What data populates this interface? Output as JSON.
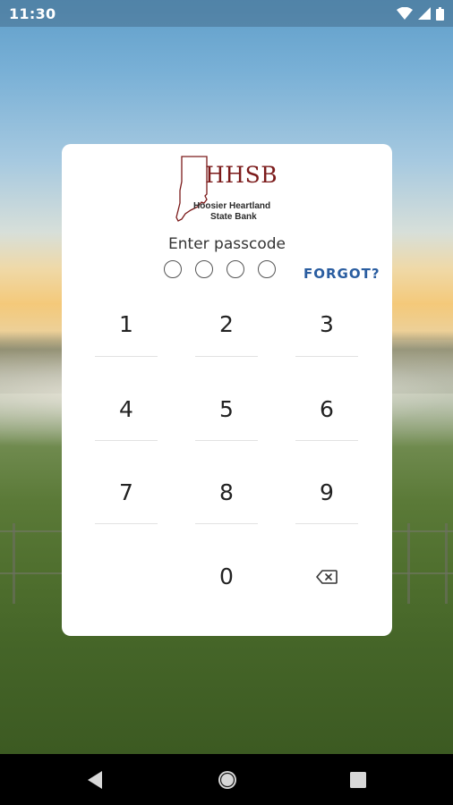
{
  "status_bar": {
    "time": "11:30",
    "icons": [
      "wifi-icon",
      "signal-icon",
      "battery-icon"
    ]
  },
  "logo": {
    "main": "HHSB",
    "line1": "Hoosier Heartland",
    "line2": "State Bank",
    "brand_color": "#7b1a1a"
  },
  "passcode": {
    "prompt": "Enter passcode",
    "digits_entered": 0,
    "digits_total": 4,
    "forgot_label": "FORGOT?",
    "link_color": "#2a5da0"
  },
  "keypad": {
    "keys": [
      "1",
      "2",
      "3",
      "4",
      "5",
      "6",
      "7",
      "8",
      "9",
      "0"
    ],
    "delete_icon": "backspace-icon"
  },
  "nav_bar": {
    "buttons": [
      "back-icon",
      "home-icon",
      "recents-icon"
    ]
  }
}
